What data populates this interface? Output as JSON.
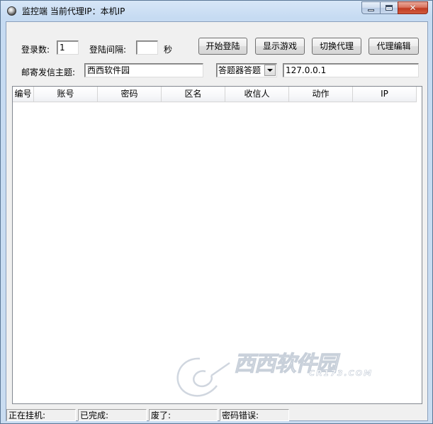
{
  "window": {
    "title": "监控端  当前代理IP：本机IP",
    "caption_buttons": [
      "minimize",
      "maximize",
      "close"
    ]
  },
  "form": {
    "login_count_label": "登录数:",
    "login_count_value": "1",
    "login_interval_label": "登陆间隔:",
    "login_interval_value": "",
    "seconds_label": "秒",
    "mail_subject_label": "邮寄发信主题:",
    "mail_subject_value": "西西软件园",
    "answer_combo_value": "答题器答题",
    "proxy_ip_value": "127.0.0.1"
  },
  "buttons": {
    "start_login": "开始登陆",
    "show_game": "显示游戏",
    "switch_proxy": "切换代理",
    "edit_proxy": "代理编辑"
  },
  "table": {
    "columns": [
      "编号",
      "账号",
      "密码",
      "区名",
      "收信人",
      "动作",
      "IP"
    ],
    "rows": []
  },
  "status_bar": {
    "hanging": "正在挂机:",
    "completed": "已完成:",
    "scrapped": "废了:",
    "password_error": "密码错误:"
  },
  "watermark": {
    "brand_cn": "西西软件园",
    "brand_en": "CR173.COM"
  }
}
